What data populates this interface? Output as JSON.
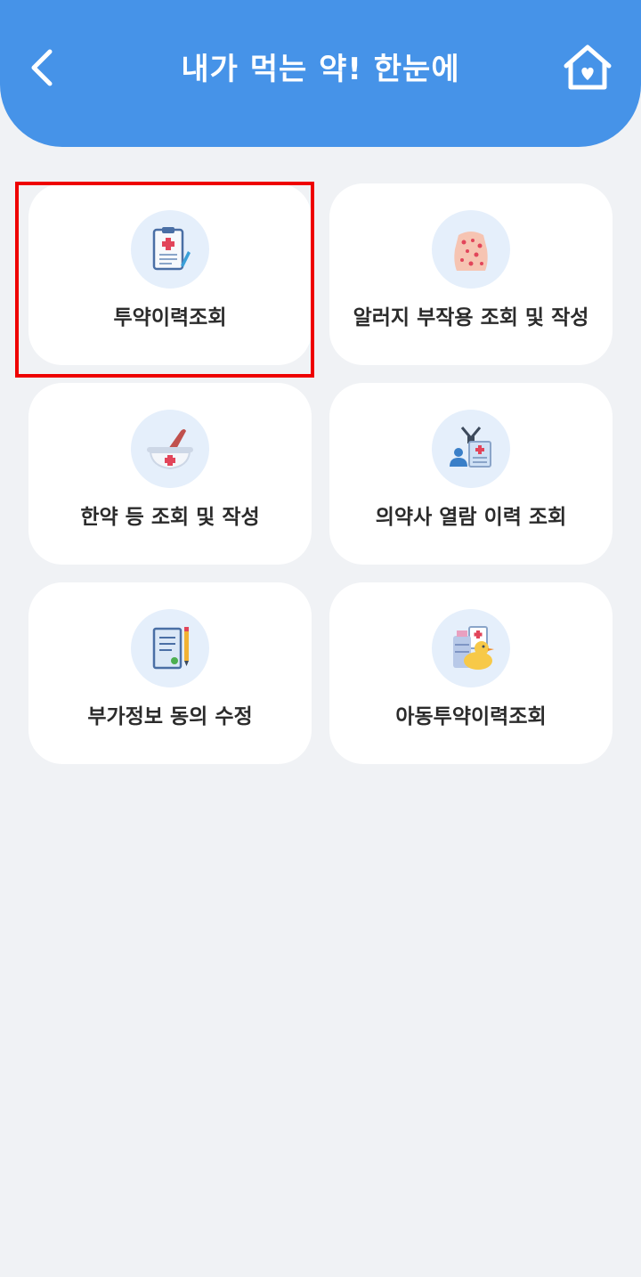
{
  "header": {
    "title": "내가 먹는 약! 한눈에",
    "back_icon": "chevron-left-icon",
    "home_icon": "home-heart-icon",
    "color": "#4693e8"
  },
  "menu": {
    "items": [
      {
        "label": "투약이력조회",
        "icon": "clipboard-icon",
        "selected": true
      },
      {
        "label": "알러지 부작용 조회 및 작성",
        "icon": "skin-rash-icon"
      },
      {
        "label": "한약 등 조회 및 작성",
        "icon": "mortar-pestle-icon"
      },
      {
        "label": "의약사 열람 이력 조회",
        "icon": "doctor-record-icon"
      },
      {
        "label": "부가정보 동의 수정",
        "icon": "consent-form-icon"
      },
      {
        "label": "아동투약이력조회",
        "icon": "child-duck-icon"
      }
    ]
  },
  "selection_color": "#ee0000"
}
